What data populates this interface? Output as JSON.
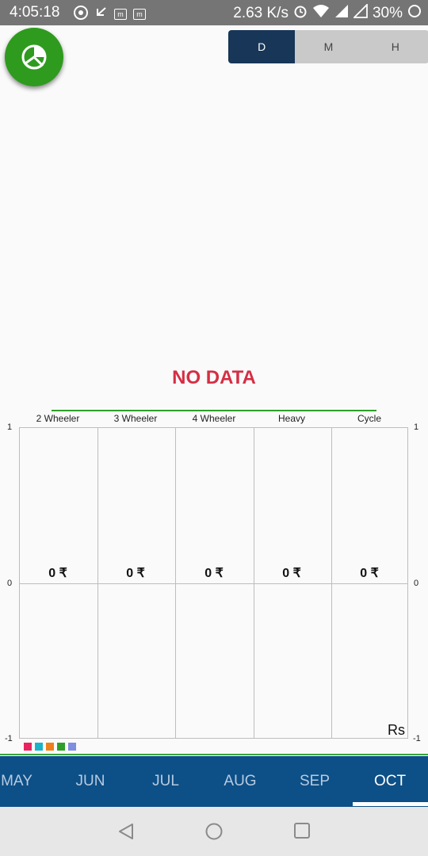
{
  "status_bar": {
    "time": "4:05:18",
    "net_speed": "2.63 K/s",
    "battery": "30%"
  },
  "toggle": {
    "options": [
      "D",
      "M",
      "H"
    ],
    "selected": "D",
    "active_color": "#173658"
  },
  "fab_icon": "pie-chart-icon",
  "no_data_text": "NO DATA",
  "chart": {
    "categories": [
      "2 Wheeler",
      "3 Wheeler",
      "4 Wheeler",
      "Heavy",
      "Cycle"
    ],
    "values": [
      "0 ₹",
      "0 ₹",
      "0 ₹",
      "0 ₹",
      "0 ₹"
    ],
    "left_axis": [
      "1",
      "0",
      "-1"
    ],
    "right_axis": [
      "1",
      "0",
      "-1"
    ],
    "unit": "Rs",
    "legend_colors": [
      "#e8245e",
      "#1ab3c9",
      "#ef7f1a",
      "#2ea02a",
      "#7f8ee0"
    ]
  },
  "months": {
    "items": [
      "MAY",
      "JUN",
      "JUL",
      "AUG",
      "SEP",
      "OCT"
    ],
    "selected": "OCT"
  },
  "nav": {
    "back_icon": "back-triangle-icon",
    "home_icon": "home-circle-icon",
    "recents_icon": "recents-square-icon"
  }
}
